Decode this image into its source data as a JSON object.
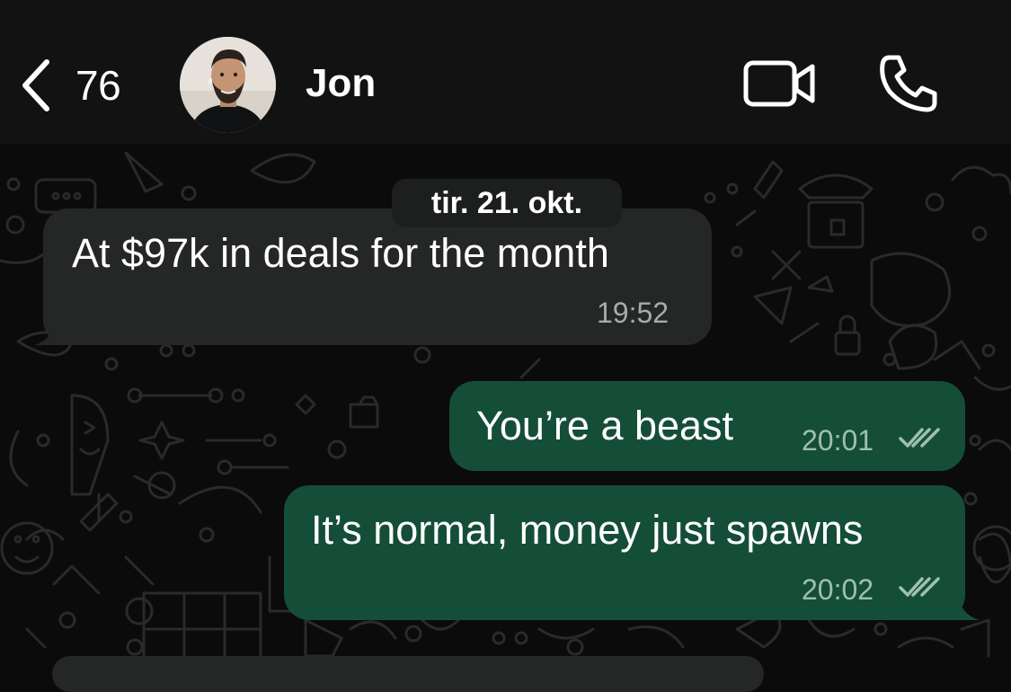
{
  "header": {
    "back_count": "76",
    "contact_name": "Jon"
  },
  "chat": {
    "date_separator": "tir. 21. okt.",
    "messages": [
      {
        "direction": "incoming",
        "text": "At $97k in deals for the month",
        "time": "19:52"
      },
      {
        "direction": "outgoing",
        "text": "You’re a beast",
        "time": "20:01",
        "status": "read"
      },
      {
        "direction": "outgoing",
        "text": "It’s normal, money just spawns",
        "time": "20:02",
        "status": "read"
      }
    ]
  },
  "colors": {
    "background": "#0b0b0b",
    "header_background": "#121212",
    "incoming_bubble": "#252626",
    "outgoing_bubble": "#154e38"
  },
  "icons": [
    "chevron-left-icon",
    "video-camera-icon",
    "phone-icon",
    "double-check-icon"
  ]
}
